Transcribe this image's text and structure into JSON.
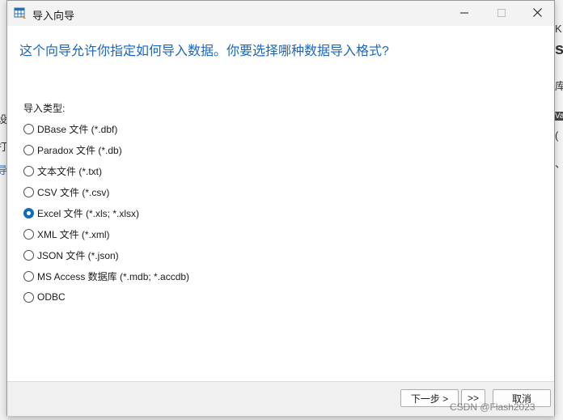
{
  "window": {
    "title": "导入向导",
    "minimize_label": "minimize",
    "maximize_label": "maximize",
    "close_label": "close"
  },
  "background": {
    "right_fragments": [
      "K",
      "s",
      "库",
      "Va",
      "(",
      "、"
    ],
    "left_fragments": [
      "设",
      "打",
      "导"
    ]
  },
  "main": {
    "headline": "这个向导允许你指定如何导入数据。你要选择哪种数据导入格式?",
    "group_label": "导入类型:",
    "options": [
      {
        "label": "DBase 文件 (*.dbf)",
        "checked": false
      },
      {
        "label": "Paradox 文件 (*.db)",
        "checked": false
      },
      {
        "label": "文本文件 (*.txt)",
        "checked": false
      },
      {
        "label": "CSV 文件 (*.csv)",
        "checked": false
      },
      {
        "label": "Excel 文件 (*.xls; *.xlsx)",
        "checked": true
      },
      {
        "label": "XML 文件 (*.xml)",
        "checked": false
      },
      {
        "label": "JSON 文件 (*.json)",
        "checked": false
      },
      {
        "label": "MS Access 数据库 (*.mdb; *.accdb)",
        "checked": false
      },
      {
        "label": "ODBC",
        "checked": false
      }
    ]
  },
  "footer": {
    "next_label": "下一步 >",
    "last_label": ">>",
    "cancel_label": "取消"
  },
  "watermark": "CSDN @Flash2023",
  "colors": {
    "accent": "#0f6cbd",
    "headline": "#1a66c4",
    "titlebar": "#f3f3f3",
    "footer": "#f0f0f0"
  }
}
